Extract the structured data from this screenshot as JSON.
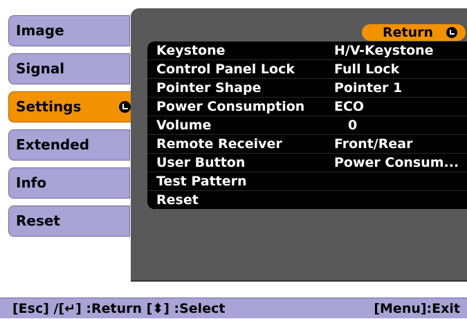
{
  "menu": {
    "items": [
      {
        "label": "Image"
      },
      {
        "label": "Signal"
      },
      {
        "label": "Settings"
      },
      {
        "label": "Extended"
      },
      {
        "label": "Info"
      },
      {
        "label": "Reset"
      }
    ],
    "active_index": 2
  },
  "return_button": {
    "label": "Return"
  },
  "settings": {
    "rows": [
      {
        "label": "Keystone",
        "value": "H/V-Keystone"
      },
      {
        "label": "Control Panel Lock",
        "value": "Full Lock"
      },
      {
        "label": "Pointer Shape",
        "value": "Pointer 1"
      },
      {
        "label": "Power Consumption",
        "value": "ECO"
      },
      {
        "label": "Volume",
        "value": "0"
      },
      {
        "label": "Remote Receiver",
        "value": "Front/Rear"
      },
      {
        "label": "User Button",
        "value": "Power Consum..."
      },
      {
        "label": "Test Pattern",
        "value": ""
      },
      {
        "label": "Reset",
        "value": ""
      }
    ]
  },
  "hint_bar": {
    "left": "[Esc] /[↵] :Return  [⬍] :Select",
    "right": "[Menu]:Exit"
  },
  "colors": {
    "accent": "#f39200",
    "menu_bg": "#a9a3d6",
    "panel_bg": "#595959",
    "list_bg": "#000000"
  }
}
